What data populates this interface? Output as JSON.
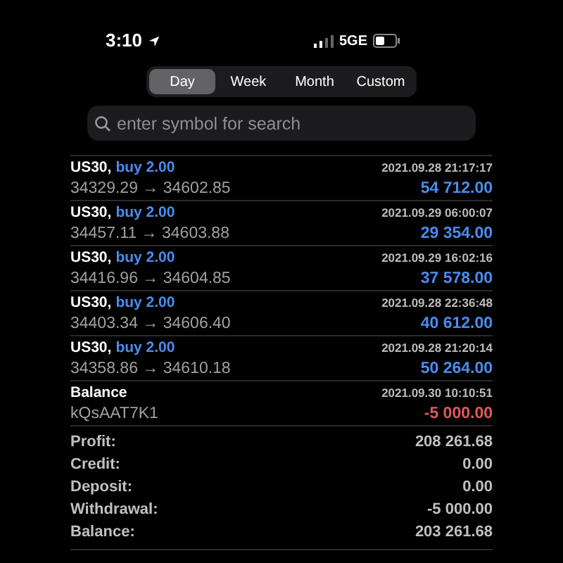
{
  "status_bar": {
    "time": "3:10",
    "network": "5GE"
  },
  "tabs": [
    {
      "label": "Day",
      "selected": true
    },
    {
      "label": "Week",
      "selected": false
    },
    {
      "label": "Month",
      "selected": false
    },
    {
      "label": "Custom",
      "selected": false
    }
  ],
  "search": {
    "placeholder": "enter symbol for search"
  },
  "deals": [
    {
      "kind": "trade",
      "symbol": "US30,",
      "side": "buy 2.00",
      "prices": "34329.29 → 34602.85",
      "time": "2021.09.28 21:17:17",
      "amount": "54 712.00",
      "color": "#4a8df0"
    },
    {
      "kind": "trade",
      "symbol": "US30,",
      "side": "buy 2.00",
      "prices": "34457.11 → 34603.88",
      "time": "2021.09.29 06:00:07",
      "amount": "29 354.00",
      "color": "#4a8df0"
    },
    {
      "kind": "trade",
      "symbol": "US30,",
      "side": "buy 2.00",
      "prices": "34416.96 → 34604.85",
      "time": "2021.09.29 16:02:16",
      "amount": "37 578.00",
      "color": "#4a8df0"
    },
    {
      "kind": "trade",
      "symbol": "US30,",
      "side": "buy 2.00",
      "prices": "34403.34 → 34606.40",
      "time": "2021.09.28 22:36:48",
      "amount": "40 612.00",
      "color": "#4a8df0"
    },
    {
      "kind": "trade",
      "symbol": "US30,",
      "side": "buy 2.00",
      "prices": "34358.86 → 34610.18",
      "time": "2021.09.28 21:20:14",
      "amount": "50 264.00",
      "color": "#4a8df0"
    },
    {
      "kind": "balance",
      "symbol": "Balance",
      "prices": "kQsAAT7K1",
      "time": "2021.09.30 10:10:51",
      "amount": "-5 000.00",
      "color": "#e05a5a"
    }
  ],
  "summary": [
    {
      "label": "Profit:",
      "value": "208 261.68"
    },
    {
      "label": "Credit:",
      "value": "0.00"
    },
    {
      "label": "Deposit:",
      "value": "0.00"
    },
    {
      "label": "Withdrawal:",
      "value": "-5 000.00"
    },
    {
      "label": "Balance:",
      "value": "203 261.68"
    }
  ]
}
